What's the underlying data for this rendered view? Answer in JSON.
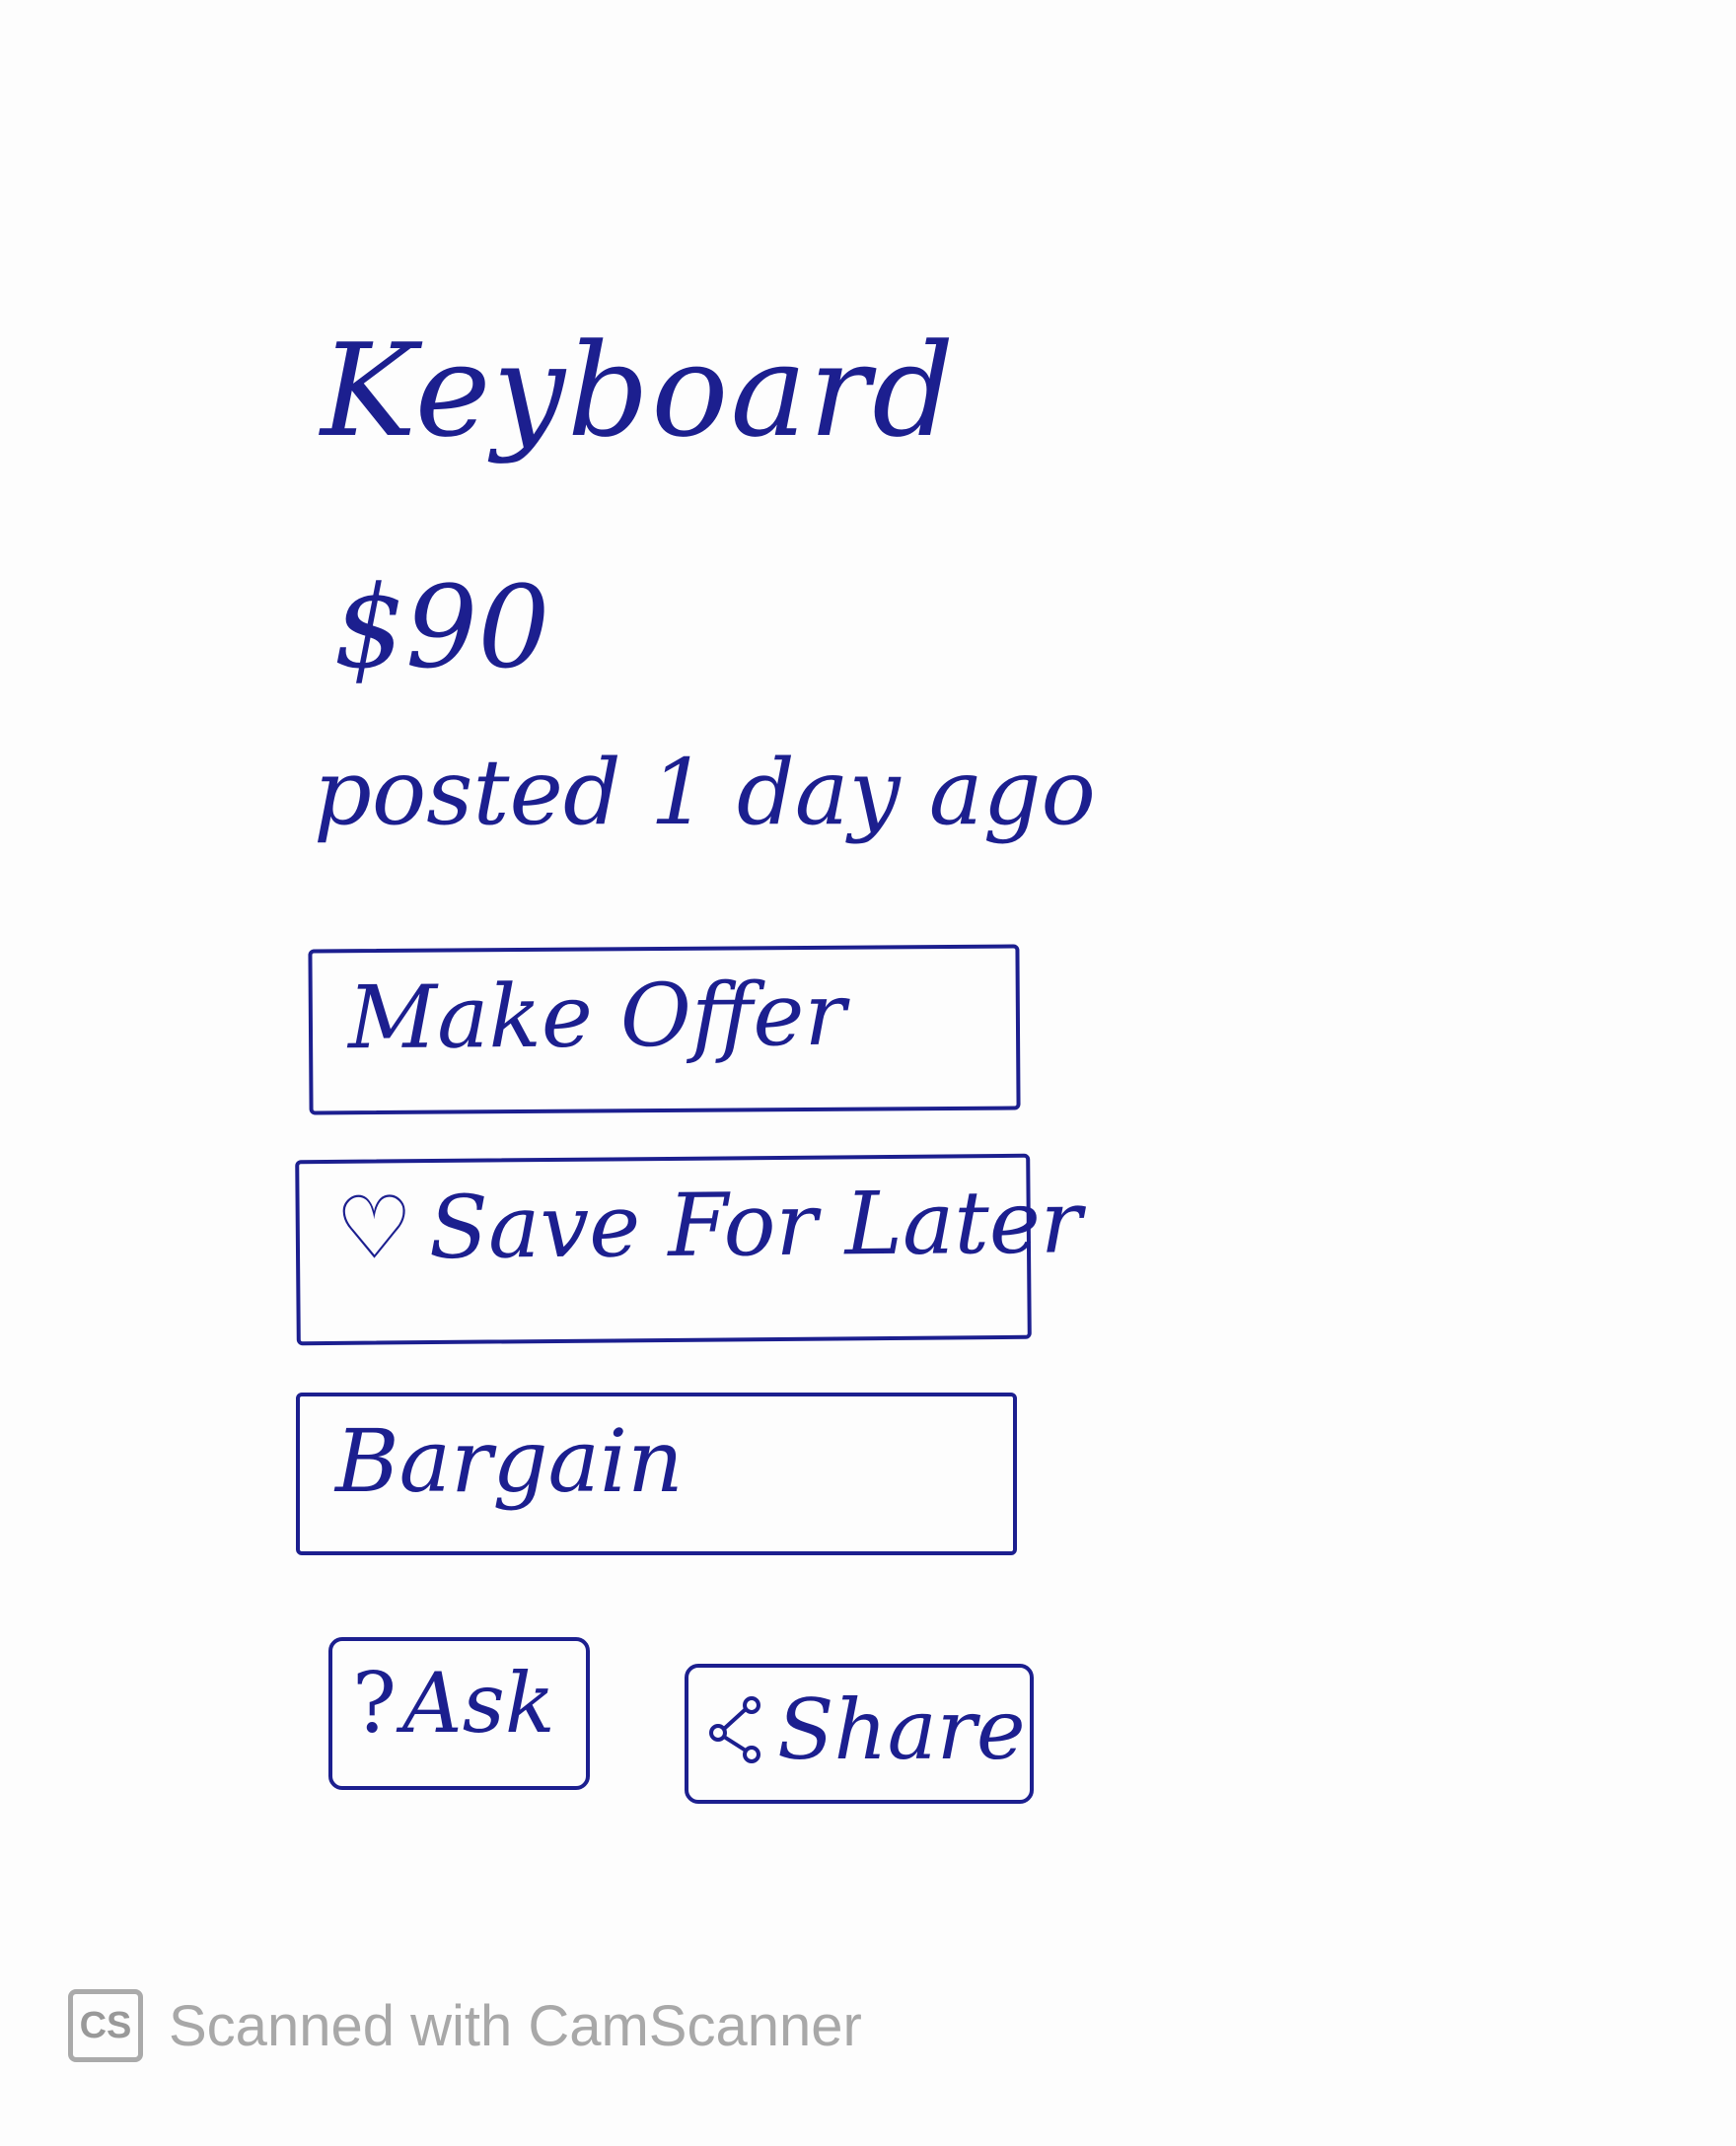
{
  "listing": {
    "title": "Keyboard",
    "price": "$90",
    "posted": "posted 1 day ago"
  },
  "actions": {
    "make_offer": "Make Offer",
    "save_for_later": "Save For Later",
    "bargain": "Bargain",
    "ask": "Ask",
    "share": "Share"
  },
  "icons": {
    "save": "heart-icon",
    "ask": "question-icon",
    "share": "share-icon"
  },
  "watermark": {
    "logo": "CS",
    "text": "Scanned with CamScanner"
  },
  "colors": {
    "ink": "#1c1f8f",
    "watermark": "#a8a8a8"
  }
}
